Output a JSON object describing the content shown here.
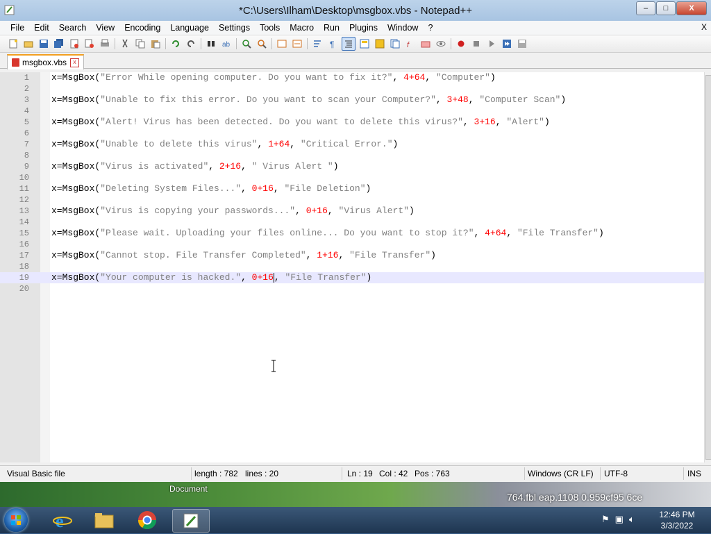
{
  "window": {
    "title": "*C:\\Users\\Ilham\\Desktop\\msgbox.vbs - Notepad++",
    "controls": {
      "minimize": "–",
      "maximize": "□",
      "close": "X"
    }
  },
  "menu": {
    "items": [
      "File",
      "Edit",
      "Search",
      "View",
      "Encoding",
      "Language",
      "Settings",
      "Tools",
      "Macro",
      "Run",
      "Plugins",
      "Window",
      "?"
    ],
    "close_doc": "X"
  },
  "tab": {
    "label": "msgbox.vbs",
    "close": "x"
  },
  "editor": {
    "lines": [
      {
        "n": "1",
        "p": "x=MsgBox(",
        "s": "\"Error While opening computer. Do you want to fix it?\"",
        "c1": ", ",
        "num": "4+64",
        "c2": ", ",
        "s2": "\"Computer\"",
        "end": ")"
      },
      {
        "n": "2"
      },
      {
        "n": "3",
        "p": "x=MsgBox(",
        "s": "\"Unable to fix this error. Do you want to scan your Computer?\"",
        "c1": ", ",
        "num": "3+48",
        "c2": ", ",
        "s2": "\"Computer Scan\"",
        "end": ")"
      },
      {
        "n": "4"
      },
      {
        "n": "5",
        "p": "x=MsgBox(",
        "s": "\"Alert! Virus has been detected. Do you want to delete this virus?\"",
        "c1": ", ",
        "num": "3+16",
        "c2": ", ",
        "s2": "\"Alert\"",
        "end": ")"
      },
      {
        "n": "6"
      },
      {
        "n": "7",
        "p": "x=MsgBox(",
        "s": "\"Unable to delete this virus\"",
        "c1": ", ",
        "num": "1+64",
        "c2": ", ",
        "s2": "\"Critical Error.\"",
        "end": ")"
      },
      {
        "n": "8"
      },
      {
        "n": "9",
        "p": "x=MsgBox(",
        "s": "\"Virus is activated\"",
        "c1": ", ",
        "num": "2+16",
        "c2": ", ",
        "s2": "\" Virus Alert \"",
        "end": ")"
      },
      {
        "n": "10"
      },
      {
        "n": "11",
        "p": "x=MsgBox(",
        "s": "\"Deleting System Files...\"",
        "c1": ", ",
        "num": "0+16",
        "c2": ", ",
        "s2": "\"File Deletion\"",
        "end": ")"
      },
      {
        "n": "12"
      },
      {
        "n": "13",
        "p": "x=MsgBox(",
        "s": "\"Virus is copying your passwords...\"",
        "c1": ", ",
        "num": "0+16",
        "c2": ", ",
        "s2": "\"Virus Alert\"",
        "end": ")"
      },
      {
        "n": "14"
      },
      {
        "n": "15",
        "p": "x=MsgBox(",
        "s": "\"Please wait. Uploading your files online... Do you want to stop it?\"",
        "c1": ", ",
        "num": "4+64",
        "c2": ", ",
        "s2": "\"File Transfer\"",
        "end": ")"
      },
      {
        "n": "16"
      },
      {
        "n": "17",
        "p": "x=MsgBox(",
        "s": "\"Cannot stop. File Transfer Completed\"",
        "c1": ", ",
        "num": "1+16",
        "c2": ", ",
        "s2": "\"File Transfer\"",
        "end": ")"
      },
      {
        "n": "18"
      },
      {
        "n": "19",
        "p": "x=MsgBox(",
        "s": "\"Your computer is hacked.\"",
        "c1": ", ",
        "num": "0+16",
        "c2": ", ",
        "s2": "\"File Transfer\"",
        "end": ")",
        "current": true
      },
      {
        "n": "20"
      }
    ]
  },
  "status": {
    "filetype": "Visual Basic file",
    "length": "length : 782",
    "lines": "lines : 20",
    "ln": "Ln : 19",
    "col": "Col : 42",
    "pos": "Pos : 763",
    "eol": "Windows (CR LF)",
    "encoding": "UTF-8",
    "mode": "INS"
  },
  "desktop": {
    "document_label": "Document",
    "background_text": "764.fbl  eap.1108     0.959cf95     6ce"
  },
  "taskbar": {
    "time": "12:46 PM",
    "date": "3/3/2022"
  },
  "colors": {
    "number": "#ff0000",
    "string": "#808080",
    "current_line": "#e8e8ff",
    "tab_accent": "#f29e1f"
  }
}
